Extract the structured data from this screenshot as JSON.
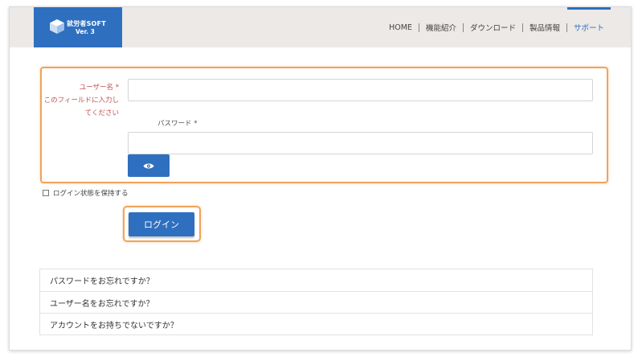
{
  "header": {
    "logo": {
      "name": "就労者SOFT",
      "version": "Ver. 3"
    },
    "nav": [
      {
        "label": "HOME",
        "active": false
      },
      {
        "label": "機能紹介",
        "active": false
      },
      {
        "label": "ダウンロード",
        "active": false
      },
      {
        "label": "製品情報",
        "active": false
      },
      {
        "label": "サポート",
        "active": true
      }
    ]
  },
  "login_form": {
    "username_label": "ユーザー名 *",
    "username_error_line1": "このフィールドに入力し",
    "username_error_line2": "てください",
    "username_value": "",
    "password_label": "パスワード *",
    "password_value": "",
    "show_password_icon": "eye-icon",
    "remember_label": "ログイン状態を保持する",
    "remember_checked": false,
    "login_button_label": "ログイン"
  },
  "help_links": [
    "パスワードをお忘れですか？",
    "ユーザー名をお忘れですか？",
    "アカウントをお持ちでないですか？"
  ],
  "colors": {
    "brand_blue": "#2f6fc0",
    "highlight_orange": "#f0a35b",
    "error_red": "#c0504d",
    "header_bg": "#ece9e6"
  }
}
